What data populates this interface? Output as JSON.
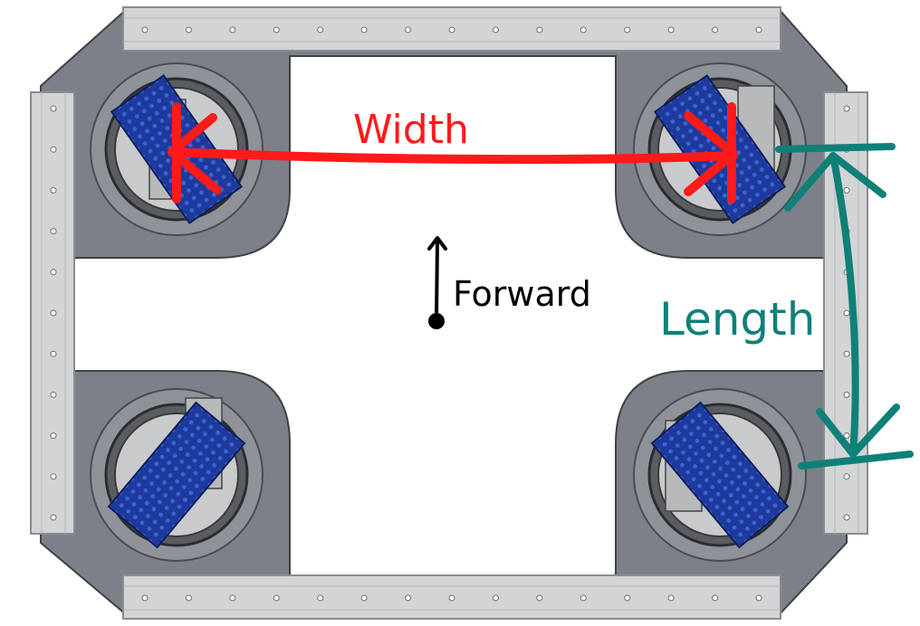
{
  "annotations": {
    "width_label": "Width",
    "length_label": "Length",
    "forward_label": "Forward"
  },
  "colors": {
    "background": "#ffffff",
    "frame": "#7c8088",
    "frame_dark": "#5f636a",
    "rail": "#d3d4d6",
    "rail_edge": "#8a8c90",
    "module_plate": "#8e9299",
    "gear_ring": "#3a3a3a",
    "heatsink": "#1d3a9c",
    "heatsink_light": "#3e63d6",
    "width_color": "#ff1a1a",
    "length_color": "#0f8078",
    "forward_color": "#000000"
  },
  "icons": {
    "wheel_module": "swerve-module-icon",
    "forward_arrow": "up-arrow-icon"
  }
}
